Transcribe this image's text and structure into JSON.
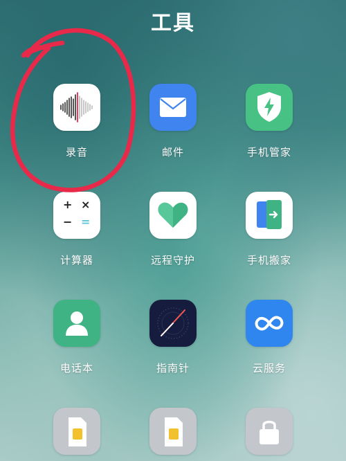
{
  "folder": {
    "title": "工具"
  },
  "apps": [
    {
      "label": "录音",
      "icon": "sound-wave-icon"
    },
    {
      "label": "邮件",
      "icon": "envelope-icon"
    },
    {
      "label": "手机管家",
      "icon": "shield-bolt-icon"
    },
    {
      "label": "计算器",
      "icon": "calculator-icon"
    },
    {
      "label": "远程守护",
      "icon": "heart-icon"
    },
    {
      "label": "手机搬家",
      "icon": "phone-transfer-icon"
    },
    {
      "label": "电话本",
      "icon": "contact-person-icon"
    },
    {
      "label": "指南针",
      "icon": "compass-icon"
    },
    {
      "label": "云服务",
      "icon": "cloud-infinity-icon"
    },
    {
      "label": "",
      "icon": "sim-card-icon"
    },
    {
      "label": "",
      "icon": "sim-card-icon"
    },
    {
      "label": "",
      "icon": "lock-icon"
    }
  ],
  "calculator": {
    "plus": "+",
    "times": "×",
    "minus": "−",
    "equals": "="
  },
  "colors": {
    "annotation": "#e8294a",
    "mail": "#3f84ef",
    "shield": "#47c184",
    "compass_needle": "#f25a52",
    "cloud": "#2f86ee"
  }
}
